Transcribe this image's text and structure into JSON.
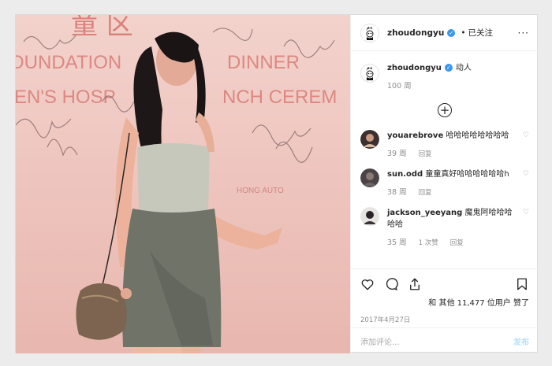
{
  "post": {
    "author": "zhoudongyu",
    "follow_state": "已关注",
    "more_label": "···",
    "caption": "动人",
    "caption_time": "100 周",
    "likes_text": "和 其他 11,477 位用户 赞了",
    "date": "2017年4月27日"
  },
  "comments": [
    {
      "user": "youarebrove",
      "text": "哈哈哈哈哈哈哈哈",
      "time": "39 周",
      "reply": "回复",
      "likes": ""
    },
    {
      "user": "sun.odd",
      "text": "童童真好哈哈哈哈哈哈h",
      "time": "38 周",
      "reply": "回复",
      "likes": ""
    },
    {
      "user": "jackson_yeeyang",
      "text": "魔鬼阿哈哈哈哈哈",
      "time": "35 周",
      "reply": "回复",
      "likes": "1 次赞"
    }
  ],
  "compose": {
    "placeholder": "添加评论...",
    "post_label": "发布"
  },
  "photo": {
    "banner_line_1": "OUNDATION",
    "banner_line_2": "DINNER",
    "banner_line_3": "EN'S HOSP",
    "banner_line_4": "NCH CEREM",
    "banner_top": "童 区",
    "logo_text": "HONG AUTO"
  },
  "colors": {
    "verified": "#3897f0",
    "backdrop": "#efc9c2"
  },
  "icons": [
    "verified-badge-icon",
    "more-options-icon",
    "plus-circle-icon",
    "heart-icon",
    "comment-icon",
    "share-icon",
    "bookmark-icon"
  ]
}
